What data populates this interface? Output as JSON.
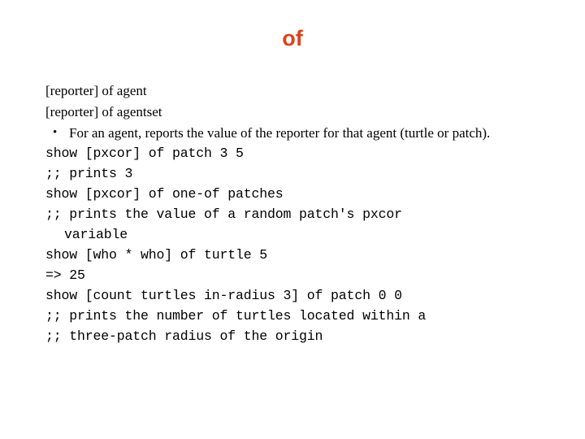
{
  "slide": {
    "title": "of",
    "title_color": "#E0401B",
    "background_color": "#FFFFFF",
    "text_color": "#000000",
    "signatures": [
      "[reporter] of agent",
      "[reporter] of agentset"
    ],
    "bullet": {
      "marker": "•",
      "text": "For an agent, reports the value of the reporter for that agent (turtle or patch)."
    },
    "code_lines": [
      {
        "text": "show [pxcor] of patch 3 5",
        "indent": false
      },
      {
        "text": ";; prints 3",
        "indent": false
      },
      {
        "text": "show [pxcor] of one-of patches",
        "indent": false
      },
      {
        "text": ";; prints the value of a random patch's pxcor",
        "indent": false
      },
      {
        "text": "variable",
        "indent": true
      },
      {
        "text": "show [who * who] of turtle 5",
        "indent": false
      },
      {
        "text": "=> 25",
        "indent": false
      },
      {
        "text": "show [count turtles in-radius 3] of patch 0 0",
        "indent": false
      },
      {
        "text": ";; prints the number of turtles located within a",
        "indent": false
      },
      {
        "text": ";; three-patch radius of the origin",
        "indent": false
      }
    ]
  }
}
